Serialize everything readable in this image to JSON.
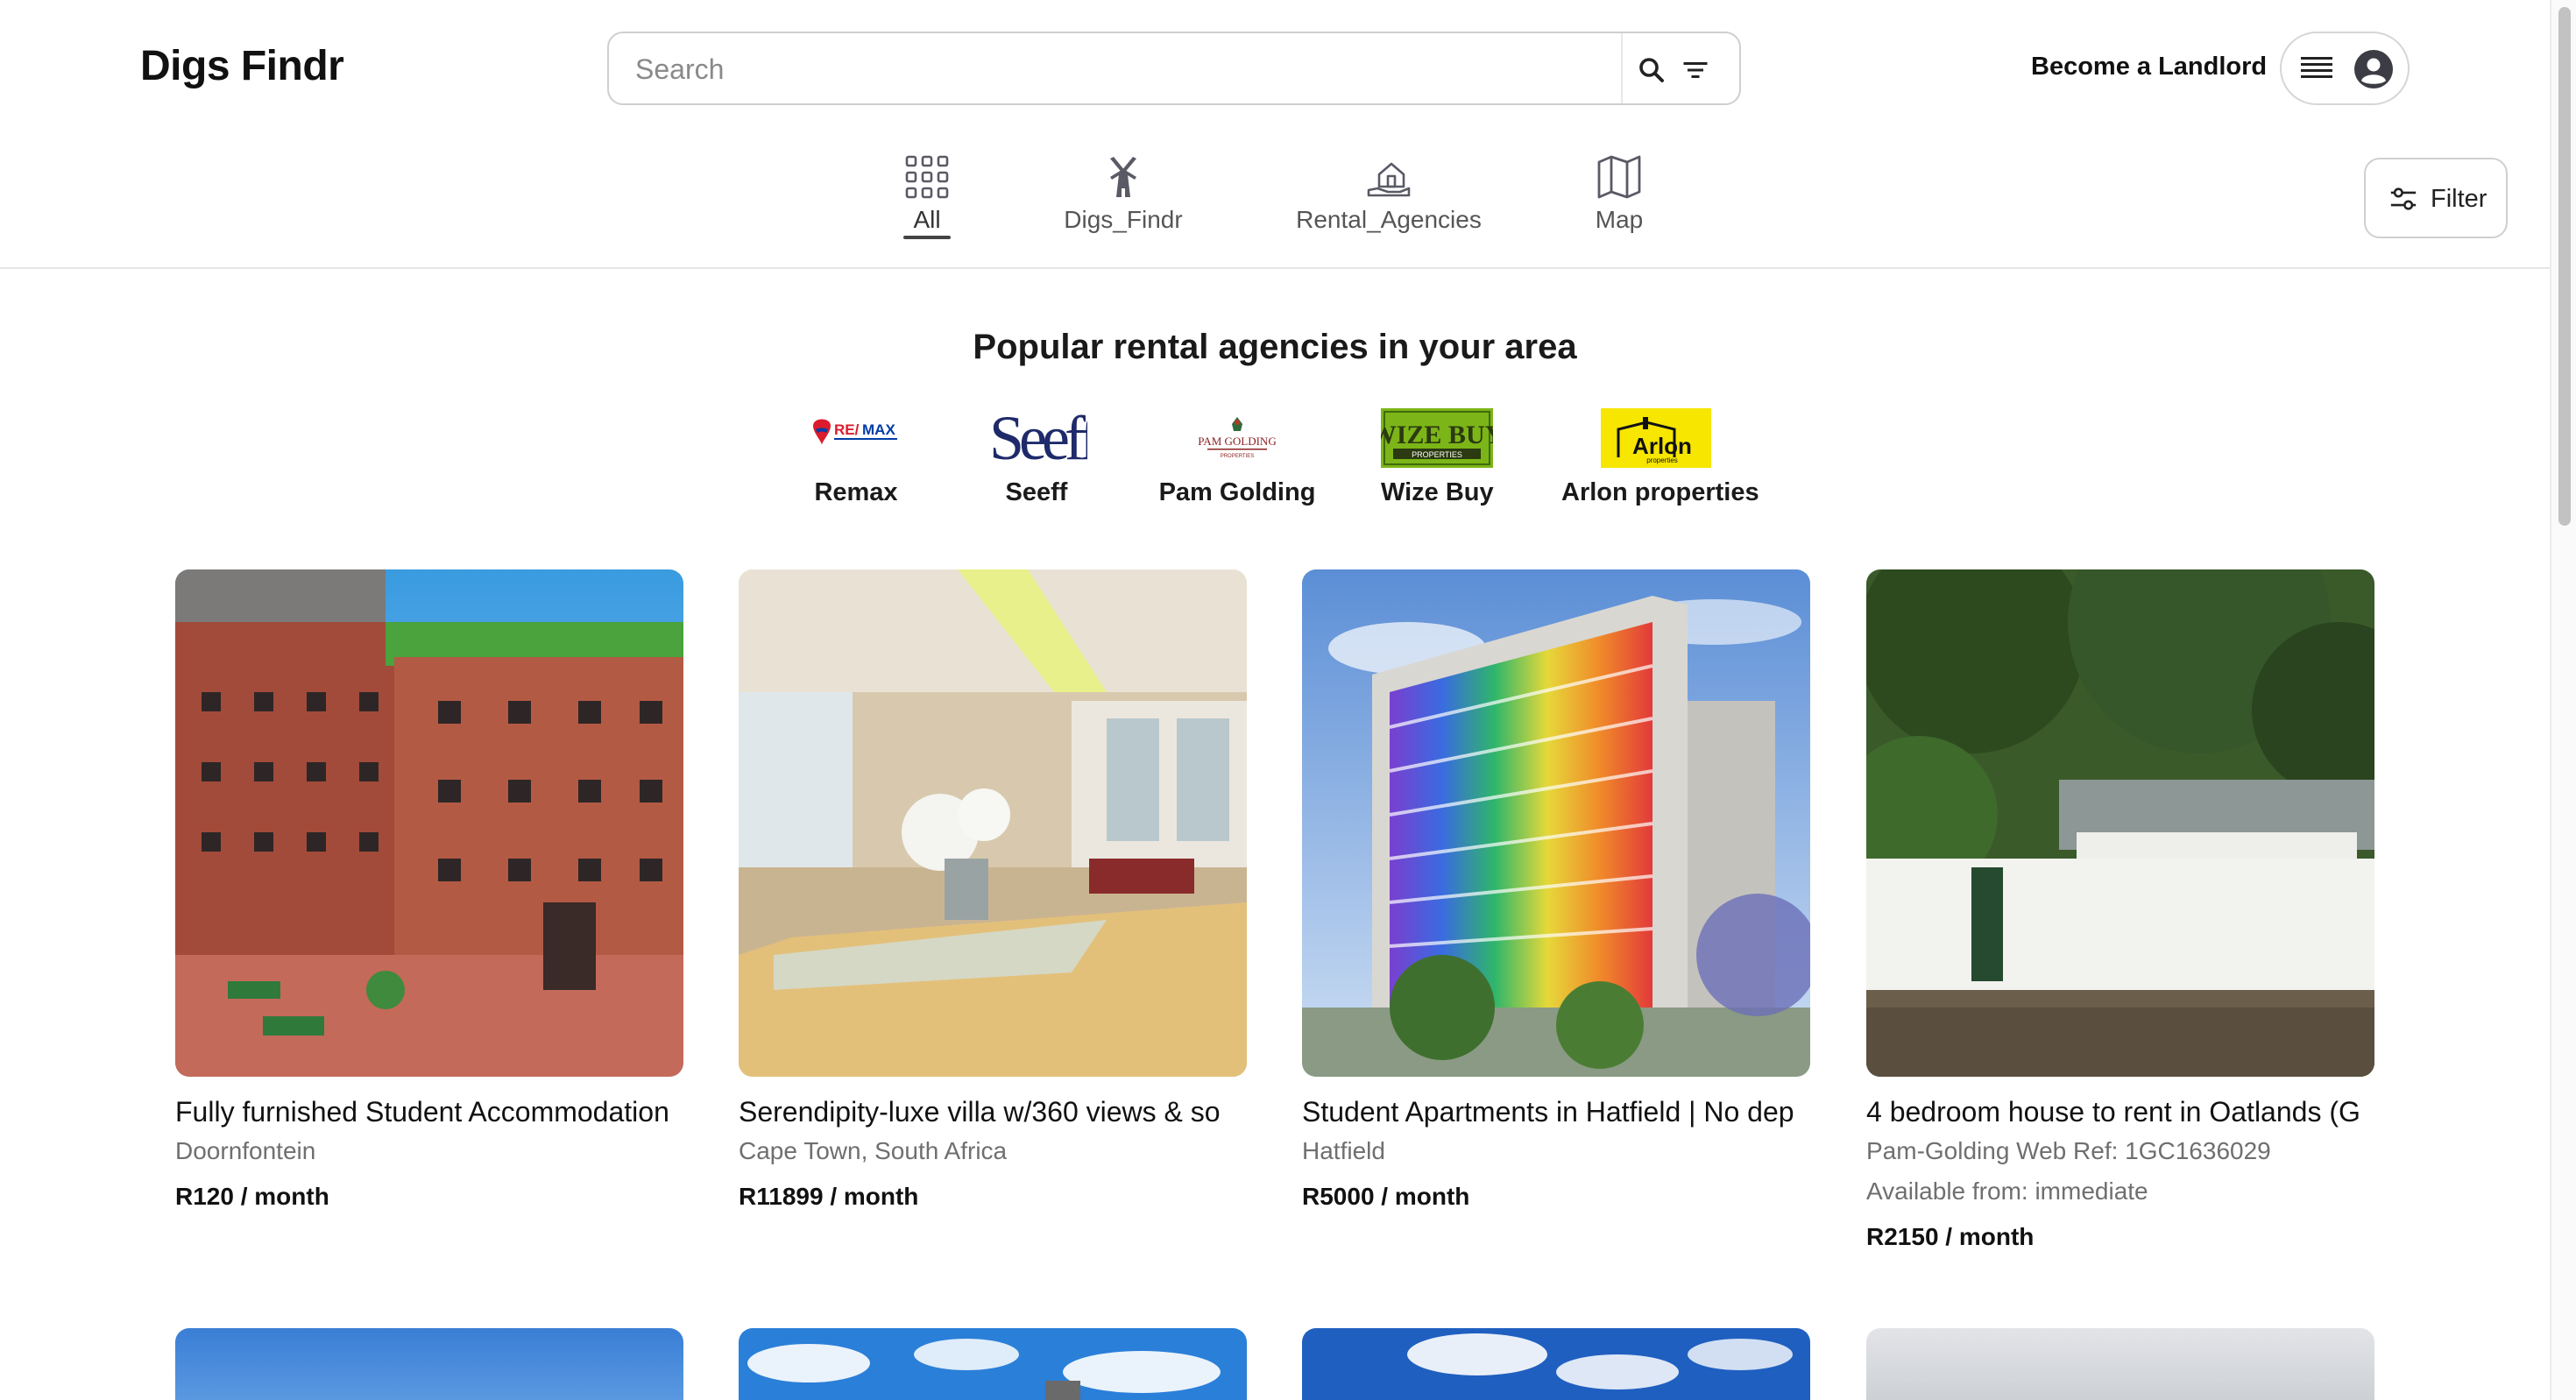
{
  "app": {
    "logo": "Digs Findr"
  },
  "search": {
    "placeholder": "Search",
    "value": ""
  },
  "header": {
    "become_landlord": "Become a Landlord"
  },
  "icons": {
    "search": "search-icon",
    "tune": "tune-icon",
    "menu": "menu-icon",
    "avatar": "avatar-icon",
    "all": "grid-icon",
    "digs": "windmill-icon",
    "agencies": "house-hand-icon",
    "map": "map-icon",
    "filter": "sliders-icon"
  },
  "categories": [
    {
      "label": "All",
      "active": true
    },
    {
      "label": "Digs_Findr",
      "active": false
    },
    {
      "label": "Rental_Agencies",
      "active": false
    },
    {
      "label": "Map",
      "active": false
    }
  ],
  "filter": {
    "label": "Filter"
  },
  "agencies": {
    "title": "Popular rental agencies in your area",
    "items": [
      {
        "name": "Remax"
      },
      {
        "name": "Seeff"
      },
      {
        "name": "Pam Golding"
      },
      {
        "name": "Wize Buy"
      },
      {
        "name": "Arlon properties"
      }
    ]
  },
  "listings": [
    {
      "title": "Fully furnished Student Accommodation",
      "location": "Doornfontein",
      "extra": "",
      "price": "R120 / month"
    },
    {
      "title": "Serendipity-luxe villa w/360 views & so",
      "location": "Cape Town, South Africa",
      "extra": "",
      "price": "R11899 / month"
    },
    {
      "title": "Student Apartments in Hatfield | No dep",
      "location": "Hatfield",
      "extra": "",
      "price": "R5000 / month"
    },
    {
      "title": "4 bedroom house to rent in Oatlands (G",
      "location": "Pam-Golding Web Ref: 1GC1636029",
      "extra": "Available from: immediate",
      "price": "R2150 / month"
    }
  ],
  "colors": {
    "accent": "#222222",
    "remax_red": "#dc1c2e",
    "remax_blue": "#003da5",
    "seeff_navy": "#1f2a6b",
    "wize_green": "#7cb518",
    "arlon_yellow": "#f6e600"
  }
}
